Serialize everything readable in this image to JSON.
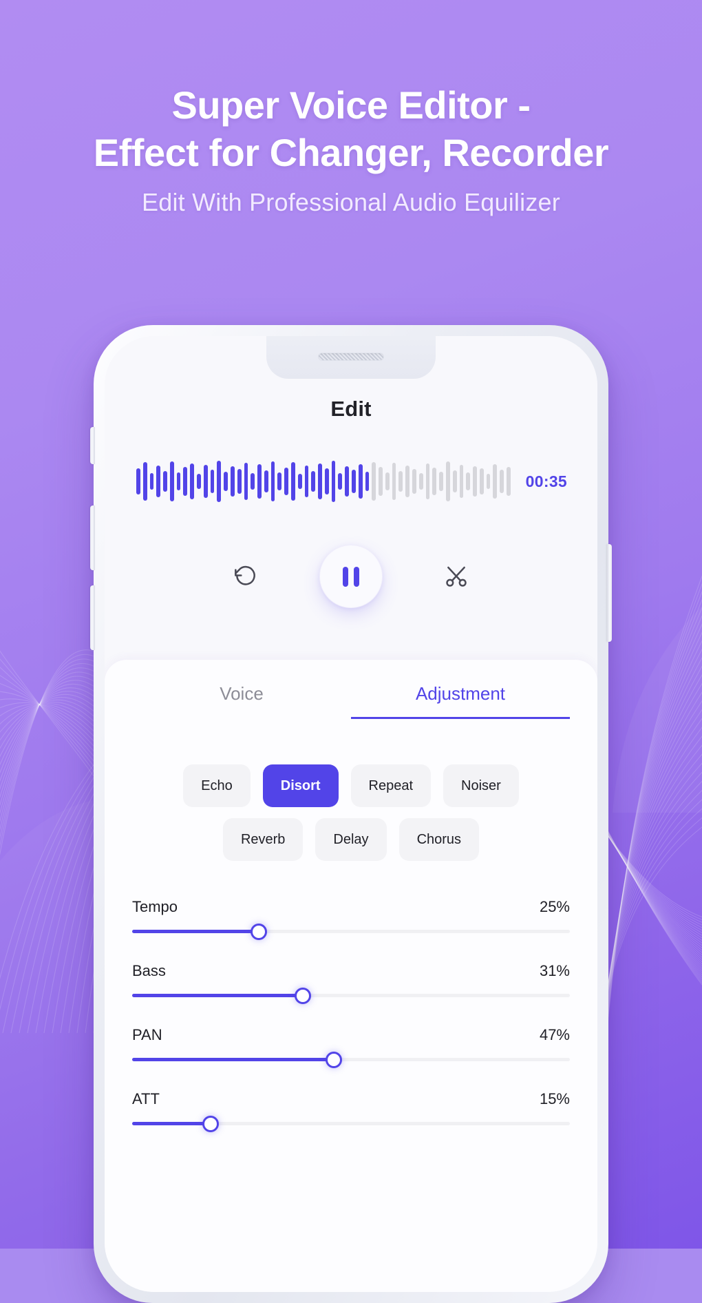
{
  "colors": {
    "accent": "#5244e8",
    "bg_gradient_top": "#b18cf2",
    "bg_gradient_bottom": "#7f56e8",
    "chip_bg": "#f3f3f6",
    "screen_bg": "#f8f8fc",
    "wave_played": "#5244e8",
    "wave_remaining": "#d6d6db"
  },
  "promo": {
    "title_line1": "Super Voice Editor -",
    "title_line2": "Effect for Changer, Recorder",
    "subtitle": "Edit With Professional Audio Equilizer"
  },
  "phone": {
    "buttons": [
      {
        "name": "mute-switch",
        "side": "left"
      },
      {
        "name": "volume-up-button",
        "side": "left"
      },
      {
        "name": "volume-down-button",
        "side": "left"
      },
      {
        "name": "power-button",
        "side": "right"
      }
    ]
  },
  "app": {
    "screen_title": "Edit",
    "player": {
      "time": "00:35",
      "progress_percent": 62,
      "wave_bar_count": 56,
      "wave_heights": [
        38,
        56,
        24,
        46,
        30,
        58,
        26,
        42,
        52,
        22,
        48,
        34,
        60,
        28,
        44,
        36,
        54,
        24,
        50,
        32,
        58,
        26,
        40,
        56,
        22,
        46,
        30,
        52,
        38,
        60,
        24,
        44,
        34,
        50,
        28,
        56,
        42,
        26,
        54,
        30,
        46,
        36,
        24,
        52,
        40,
        28,
        58,
        32,
        48,
        26,
        44,
        38,
        22,
        50,
        34,
        42
      ],
      "controls": [
        {
          "name": "undo-button",
          "icon": "rotate-left-icon",
          "label": "Undo"
        },
        {
          "name": "play-pause-button",
          "icon": "pause-icon",
          "label": "Pause",
          "state": "playing"
        },
        {
          "name": "cut-button",
          "icon": "scissors-icon",
          "label": "Cut"
        }
      ]
    },
    "tabs": [
      {
        "label": "Voice",
        "active": false
      },
      {
        "label": "Adjustment",
        "active": true
      }
    ],
    "effects": {
      "row1": [
        {
          "label": "Echo",
          "selected": false
        },
        {
          "label": "Disort",
          "selected": true
        },
        {
          "label": "Repeat",
          "selected": false
        },
        {
          "label": "Noiser",
          "selected": false
        }
      ],
      "row2": [
        {
          "label": "Reverb",
          "selected": false
        },
        {
          "label": "Delay",
          "selected": false
        },
        {
          "label": "Chorus",
          "selected": false
        }
      ]
    },
    "sliders": [
      {
        "label": "Tempo",
        "value": "25%",
        "fill_percent": 29
      },
      {
        "label": "Bass",
        "value": "31%",
        "fill_percent": 39
      },
      {
        "label": "PAN",
        "value": "47%",
        "fill_percent": 46
      },
      {
        "label": "ATT",
        "value": "15%",
        "fill_percent": 18
      }
    ]
  }
}
